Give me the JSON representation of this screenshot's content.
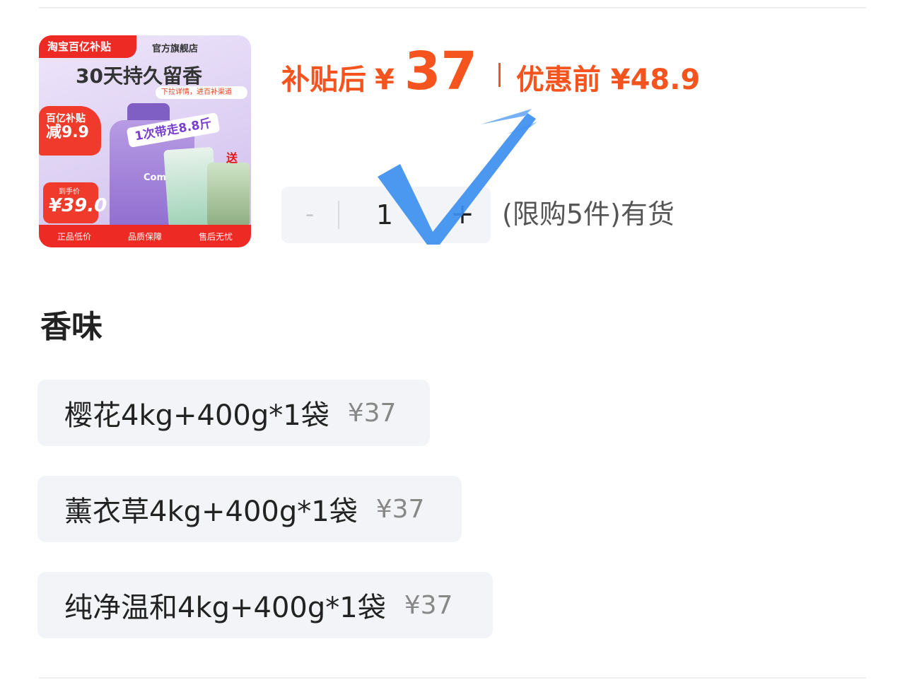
{
  "product_image": {
    "top_tag": "淘宝百亿补贴",
    "store": "官方旗舰店",
    "headline": "30天持久留香",
    "note": "下拉详情，进百补渠道",
    "ribbon": "1次带走8.8斤",
    "brand": "Comfort 金纺",
    "gift_label": "送",
    "subsidy_line1": "百亿补贴",
    "subsidy_line2": "减9.9",
    "price_tag_label": "到手价",
    "price_tag_value": "¥39.0",
    "footer": [
      "正品低价",
      "品质保障",
      "售后无忧"
    ]
  },
  "price": {
    "label": "补贴后",
    "currency": "¥",
    "value": "37",
    "original_label": "优惠前 ¥48.9"
  },
  "quantity": {
    "minus": "-",
    "value": "1",
    "plus": "+",
    "stock_note": "(限购5件)有货"
  },
  "section": {
    "title": "香味"
  },
  "variants": [
    {
      "name": "樱花4kg+400g*1袋",
      "price": "¥37"
    },
    {
      "name": "薰衣草4kg+400g*1袋",
      "price": "¥37"
    },
    {
      "name": "纯净温和4kg+400g*1袋",
      "price": "¥37"
    }
  ],
  "colors": {
    "accent": "#f5541f",
    "badge_red": "#ee2a24",
    "check_blue": "#3d8ff0",
    "chip_bg": "#f3f4f8"
  }
}
